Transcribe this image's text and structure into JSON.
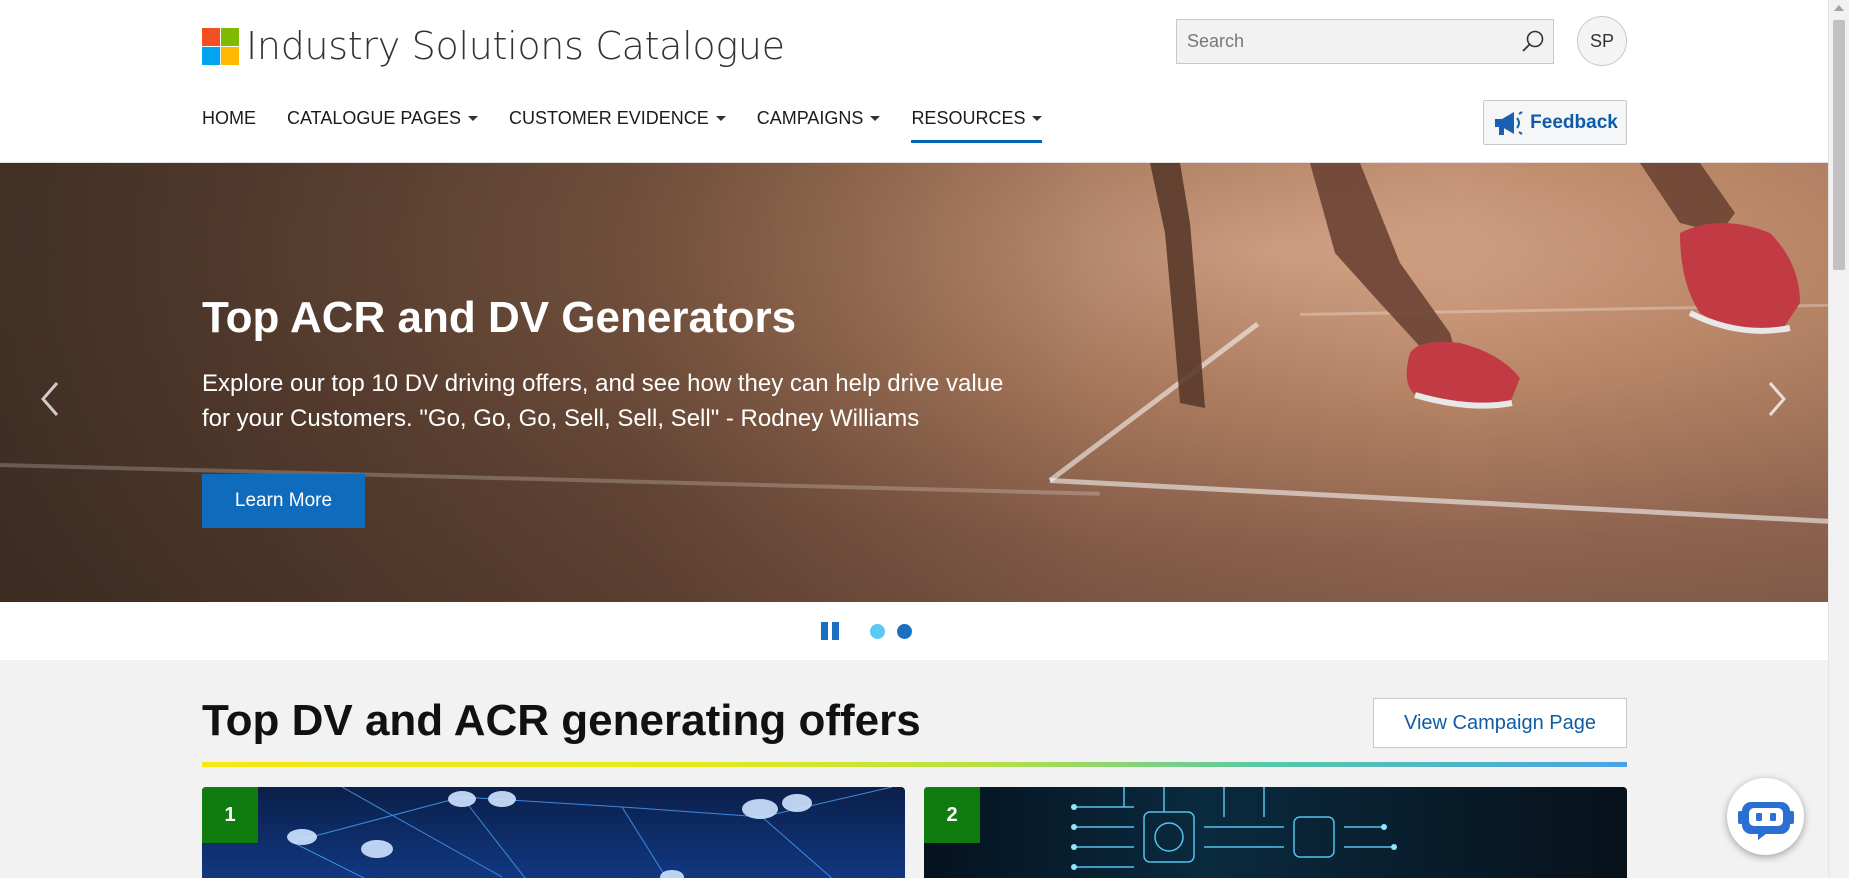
{
  "header": {
    "brand_title": "Industry Solutions Catalogue",
    "logo_colors": [
      "#f25022",
      "#7fba00",
      "#00a4ef",
      "#ffb900"
    ],
    "search_placeholder": "Search",
    "avatar_initials": "SP",
    "feedback_label": "Feedback"
  },
  "nav": {
    "items": [
      {
        "label": "HOME",
        "dropdown": false
      },
      {
        "label": "CATALOGUE PAGES",
        "dropdown": true
      },
      {
        "label": "CUSTOMER EVIDENCE",
        "dropdown": true
      },
      {
        "label": "CAMPAIGNS",
        "dropdown": true
      },
      {
        "label": "RESOURCES",
        "dropdown": true,
        "active": true
      }
    ]
  },
  "hero": {
    "title": "Top ACR and DV Generators",
    "description": "Explore our top 10 DV driving offers, and see how they can help drive value for your Customers. \"Go, Go, Go, Sell, Sell, Sell\" - Rodney Williams",
    "button_label": "Learn More",
    "prev_icon": "chevron-left-icon",
    "next_icon": "chevron-right-icon"
  },
  "carousel": {
    "pause_icon": "pause-icon",
    "dots": [
      {
        "color": "#5bc8f5",
        "active": false
      },
      {
        "color": "#1a6fc0",
        "active": true
      }
    ]
  },
  "section": {
    "title": "Top DV and ACR generating offers",
    "view_button_label": "View Campaign Page",
    "cards": [
      {
        "number": "1"
      },
      {
        "number": "2"
      }
    ]
  },
  "colors": {
    "accent_blue": "#0f6cbd",
    "badge_green": "#107c10"
  }
}
